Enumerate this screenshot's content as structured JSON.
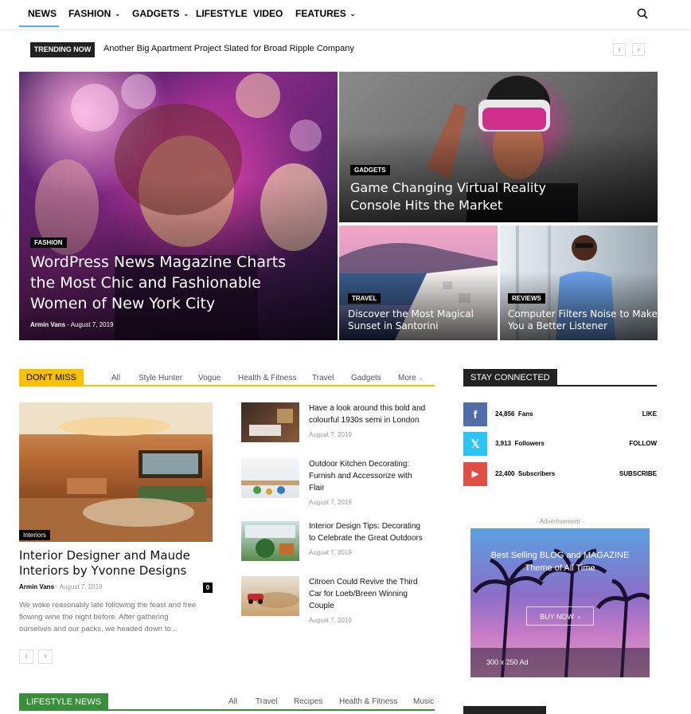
{
  "nav": {
    "items": [
      {
        "label": "NEWS",
        "has_caret": false
      },
      {
        "label": "FASHION",
        "has_caret": true
      },
      {
        "label": "GADGETS",
        "has_caret": true
      },
      {
        "label": "LIFESTYLE",
        "has_caret": false
      },
      {
        "label": "VIDEO",
        "has_caret": false
      },
      {
        "label": "FEATURES",
        "has_caret": true
      }
    ],
    "active": "NEWS",
    "caret": "⌄",
    "accent_color": "#4db2ec"
  },
  "trending": {
    "badge": "TRENDING NOW",
    "headline": "Another Big Apartment Project Slated for Broad Ripple Company",
    "prev": "‹",
    "next": "›"
  },
  "hero": [
    {
      "category": "FASHION",
      "title_lines": [
        "WordPress News Magazine Charts",
        "the Most Chic and Fashionable",
        "Women of New York City"
      ],
      "author": "Armin Vans",
      "date": "August 7, 2019"
    },
    {
      "category": "GADGETS",
      "title_lines": [
        "Game Changing Virtual Reality",
        "Console Hits the Market"
      ]
    },
    {
      "category": "TRAVEL",
      "title_lines": [
        "Discover the Most Magical",
        "Sunset in Santorini"
      ]
    },
    {
      "category": "REVIEWS",
      "title_lines": [
        "Computer Filters Noise to Make",
        "You a Better Listener"
      ]
    }
  ],
  "dont_miss": {
    "label": "DON'T MISS",
    "accent_color": "#f9c100",
    "filters": [
      "All",
      "Style Hunter",
      "Vogue",
      "Health & Fitness",
      "Travel",
      "Gadgets",
      "More"
    ],
    "more_caret": "⌄",
    "main": {
      "category": "Interiors",
      "title_lines": [
        "Interior Designer and Maude",
        "Interiors by Yvonne Designs"
      ],
      "author": "Armin Vans",
      "date": "August 7, 2019",
      "comments": "0",
      "excerpt_lines": [
        "We woke reasonably late following the feast and free",
        "flowing wine the night before. After gathering",
        "ourselves and our packs, we headed down to..."
      ]
    },
    "side": [
      {
        "title_lines": [
          "Have a look around this bold and",
          "colourful 1930s semi in London"
        ],
        "date": "August 7, 2019"
      },
      {
        "title_lines": [
          "Outdoor Kitchen Decorating:",
          "Furnish and Accessorize with",
          "Flair"
        ],
        "date": "August 7, 2019"
      },
      {
        "title_lines": [
          "Interior Design Tips: Decorating",
          "to Celebrate the Great Outdoors"
        ],
        "date": "August 7, 2019"
      },
      {
        "title_lines": [
          "Citroen Could Revive the Third",
          "Car for Loeb/Breen Winning",
          "Couple"
        ],
        "date": "August 7, 2019"
      }
    ],
    "prev": "‹",
    "next": "›"
  },
  "stay_connected": {
    "label": "STAY CONNECTED",
    "rows": [
      {
        "network": "facebook",
        "glyph": "f",
        "count": "24,856",
        "unit": "Fans",
        "action": "LIKE",
        "color": "#516eab"
      },
      {
        "network": "x",
        "glyph": "𝕏",
        "count": "3,913",
        "unit": "Followers",
        "action": "FOLLOW",
        "color": "#29c5f6"
      },
      {
        "network": "youtube",
        "glyph": "▶",
        "count": "22,400",
        "unit": "Subscribers",
        "action": "SUBSCRIBE",
        "color": "#e14e42"
      }
    ]
  },
  "advertisement": {
    "label": "- Advertisement -",
    "line1": "Best Selling BLOG and MAGAZINE",
    "line2": "Theme of All Time",
    "button": "BUY NOW",
    "button_arrow": "›",
    "size": "300 x 250 Ad"
  },
  "lifestyle_news": {
    "label": "LIFESTYLE NEWS",
    "accent_color": "#3a8f3a",
    "filters": [
      "All",
      "Travel",
      "Recipes",
      "Health & Fitness",
      "Music"
    ]
  }
}
